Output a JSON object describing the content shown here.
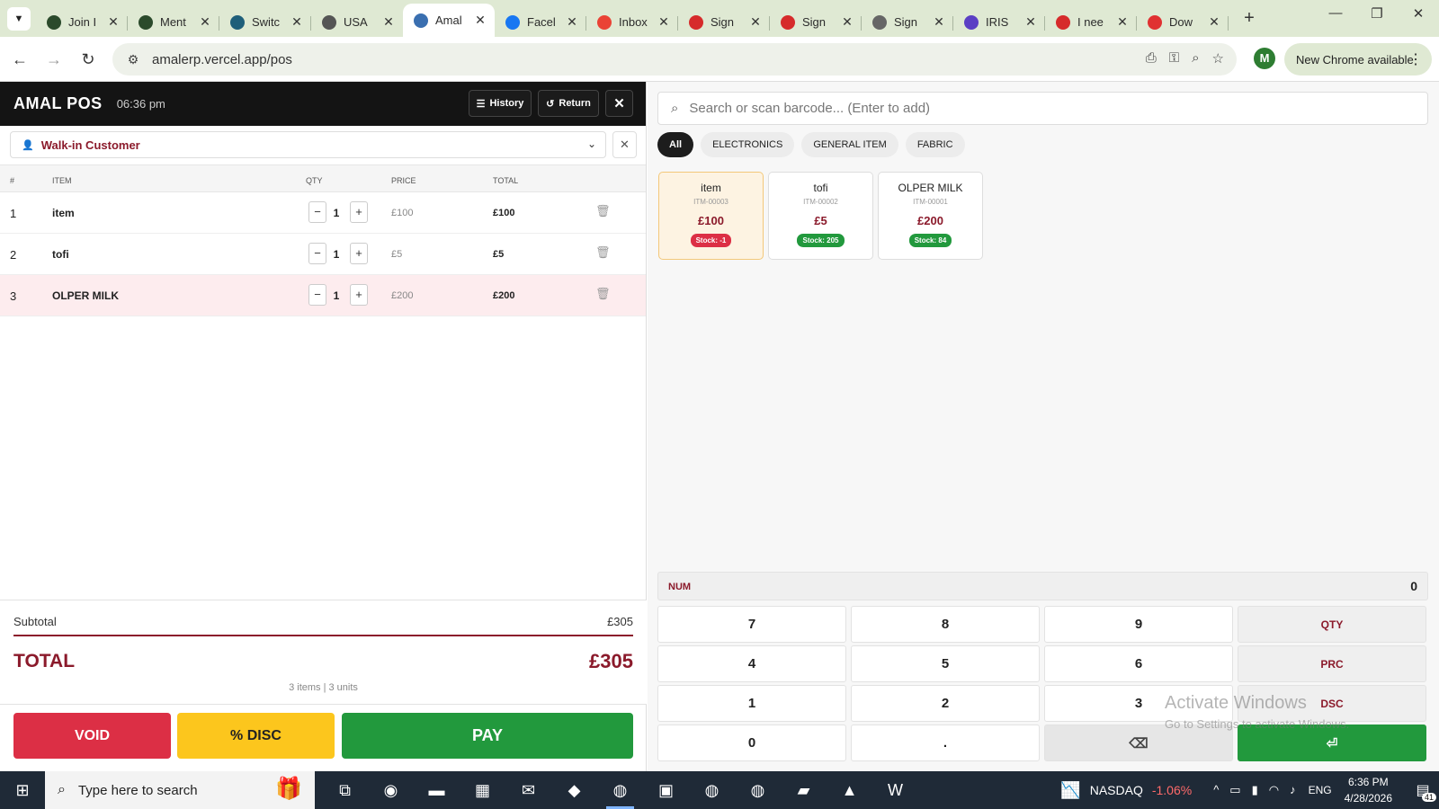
{
  "browser": {
    "tabs": [
      {
        "title": "Join I",
        "icon": "gear-icon",
        "color": "#2b4a2b"
      },
      {
        "title": "Ment",
        "icon": "gear-icon",
        "color": "#2b4a2b"
      },
      {
        "title": "Switc",
        "icon": "react-icon",
        "color": "#1f5f7a"
      },
      {
        "title": "USA",
        "icon": "chatgpt-icon",
        "color": "#555555"
      },
      {
        "title": "Amal",
        "icon": "pos-icon",
        "color": "#3a6fb0"
      },
      {
        "title": "Facel",
        "icon": "facebook-icon",
        "color": "#1877f2"
      },
      {
        "title": "Inbox",
        "icon": "gmail-icon",
        "color": "#ea4335"
      },
      {
        "title": "Sign",
        "icon": "maple-leaf-icon",
        "color": "#d62b2b"
      },
      {
        "title": "Sign",
        "icon": "maple-leaf-icon",
        "color": "#d62b2b"
      },
      {
        "title": "Sign",
        "icon": "globe-icon",
        "color": "#666666"
      },
      {
        "title": "IRIS",
        "icon": "iris-icon",
        "color": "#5b3fc4"
      },
      {
        "title": "I nee",
        "icon": "maple-leaf-icon",
        "color": "#d62b2b"
      },
      {
        "title": "Dow",
        "icon": "heart-icon",
        "color": "#e03131"
      }
    ],
    "active_tab_index": 4,
    "url": "amalerp.vercel.app/pos",
    "profile_initial": "M",
    "update_label": "New Chrome available"
  },
  "pos": {
    "brand": "AMAL POS",
    "time": "06:36 pm",
    "history_label": "History",
    "return_label": "Return",
    "customer": "Walk-in Customer",
    "columns": {
      "idx": "#",
      "item": "ITEM",
      "qty": "QTY",
      "price": "PRICE",
      "total": "TOTAL"
    },
    "cart": [
      {
        "idx": "1",
        "name": "item",
        "qty": "1",
        "price": "£100",
        "total": "£100"
      },
      {
        "idx": "2",
        "name": "tofi",
        "qty": "1",
        "price": "£5",
        "total": "£5"
      },
      {
        "idx": "3",
        "name": "OLPER MILK",
        "qty": "1",
        "price": "£200",
        "total": "£200"
      }
    ],
    "selected_row": 2,
    "subtotal_label": "Subtotal",
    "subtotal": "£305",
    "total_label": "TOTAL",
    "total": "£305",
    "counts": "3 items | 3 units",
    "void_label": "VOID",
    "disc_label": "% DISC",
    "pay_label": "PAY"
  },
  "catalog": {
    "search_placeholder": "Search or scan barcode... (Enter to add)",
    "categories": [
      "All",
      "ELECTRONICS",
      "GENERAL ITEM",
      "FABRIC"
    ],
    "active_category": 0,
    "products": [
      {
        "name": "item",
        "sku": "ITM-00003",
        "price": "£100",
        "stock": "Stock: -1",
        "stock_status": "negative"
      },
      {
        "name": "tofi",
        "sku": "ITM-00002",
        "price": "£5",
        "stock": "Stock: 205",
        "stock_status": "positive"
      },
      {
        "name": "OLPER MILK",
        "sku": "ITM-00001",
        "price": "£200",
        "stock": "Stock: 84",
        "stock_status": "positive"
      }
    ],
    "highlighted_product": 0
  },
  "keypad": {
    "mode": "NUM",
    "value": "0",
    "keys": [
      {
        "label": "7"
      },
      {
        "label": "8"
      },
      {
        "label": "9"
      },
      {
        "label": "QTY",
        "fn": true
      },
      {
        "label": "4"
      },
      {
        "label": "5"
      },
      {
        "label": "6"
      },
      {
        "label": "PRC",
        "fn": true
      },
      {
        "label": "1"
      },
      {
        "label": "2"
      },
      {
        "label": "3"
      },
      {
        "label": "DSC",
        "fn": true
      },
      {
        "label": "0"
      },
      {
        "label": "."
      },
      {
        "label": "⌫",
        "kind": "back"
      },
      {
        "label": "⏎",
        "kind": "enter"
      }
    ]
  },
  "watermark": {
    "line1": "Activate Windows",
    "line2": "Go to Settings to activate Windows."
  },
  "taskbar": {
    "search_placeholder": "Type here to search",
    "apps": [
      {
        "name": "task-view",
        "glyph": "⧉"
      },
      {
        "name": "edge",
        "glyph": "◉"
      },
      {
        "name": "file-explorer",
        "glyph": "▬"
      },
      {
        "name": "store",
        "glyph": "▦"
      },
      {
        "name": "outlook",
        "glyph": "✉"
      },
      {
        "name": "app",
        "glyph": "◆"
      },
      {
        "name": "chrome",
        "glyph": "◍",
        "active": true
      },
      {
        "name": "app2",
        "glyph": "▣"
      },
      {
        "name": "chrome2",
        "glyph": "◍"
      },
      {
        "name": "chrome3",
        "glyph": "◍"
      },
      {
        "name": "notes",
        "glyph": "▰"
      },
      {
        "name": "photos",
        "glyph": "▲"
      },
      {
        "name": "word",
        "glyph": "W"
      }
    ],
    "ticker_name": "NASDAQ",
    "ticker_change": "-1.06%",
    "lang": "ENG",
    "time": "6:36 PM",
    "date": "4/28/2026",
    "notification_count": "41"
  }
}
